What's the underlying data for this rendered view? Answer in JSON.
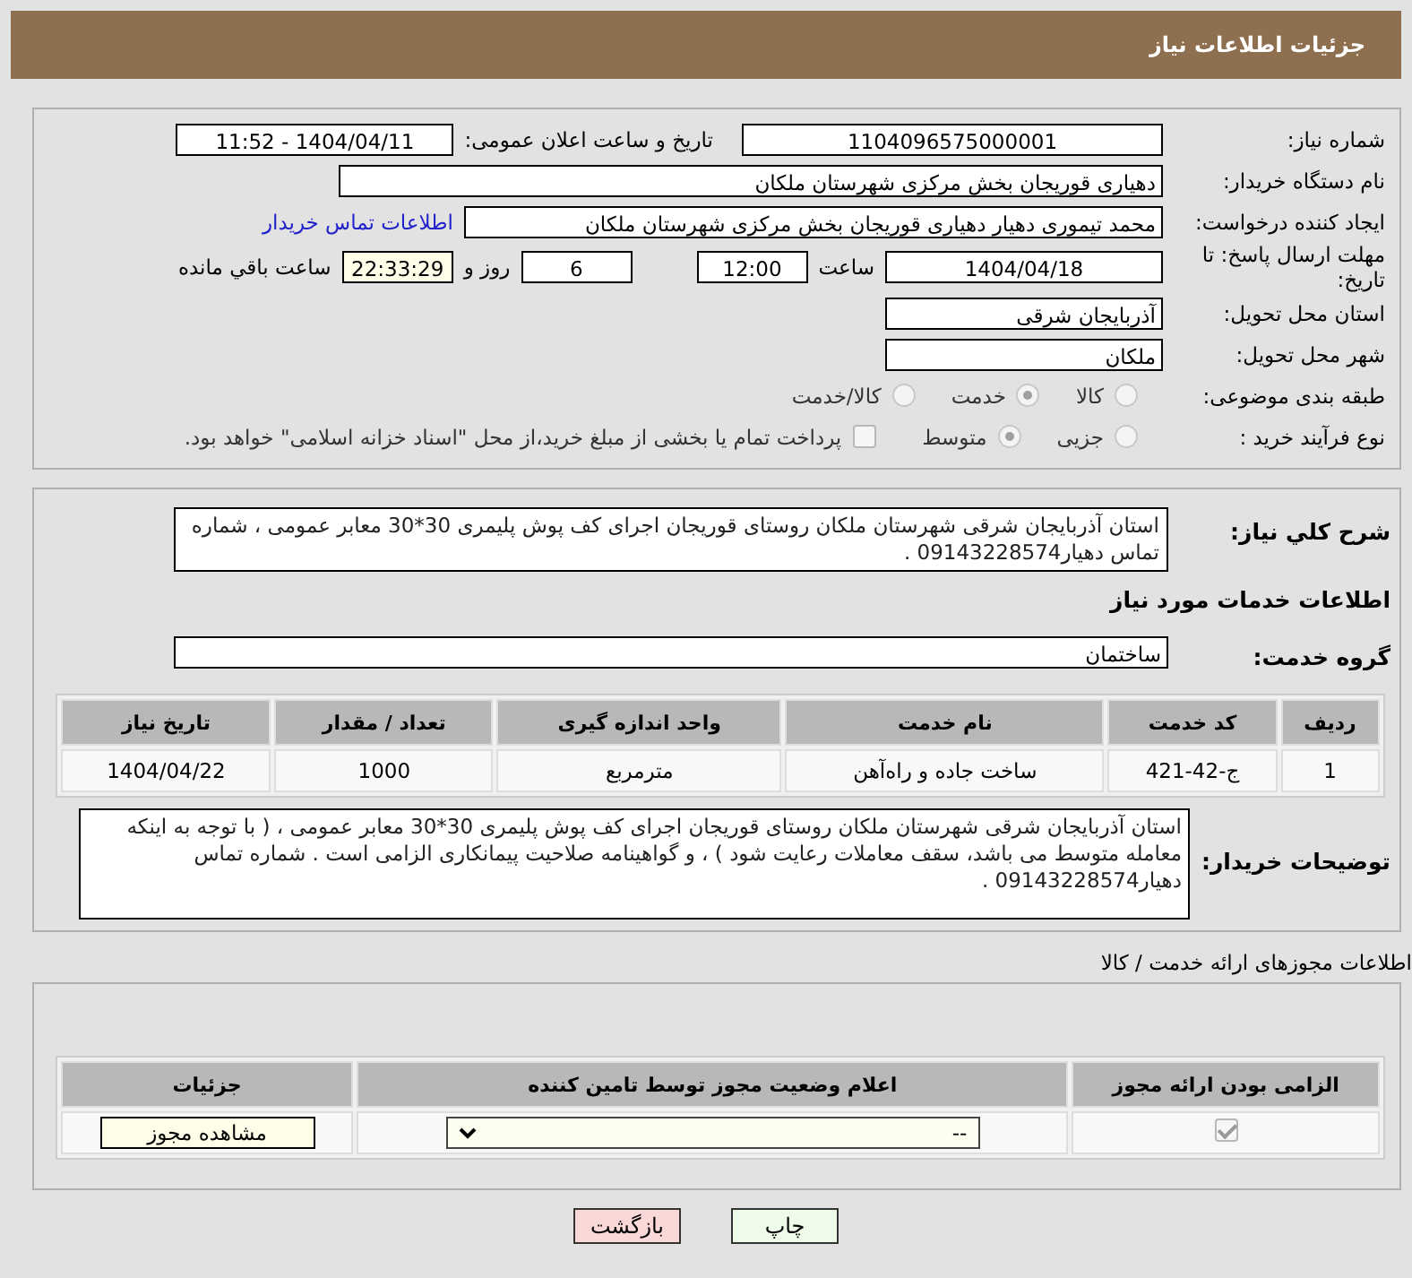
{
  "header": {
    "title": "جزئیات اطلاعات نیاز"
  },
  "details": {
    "need_number": {
      "label": "شماره نیاز:",
      "value": "1104096575000001"
    },
    "announce": {
      "label": "تاریخ و ساعت اعلان عمومی:",
      "value": "1404/04/11 - 11:52"
    },
    "buyer_org": {
      "label": "نام دستگاه خریدار:",
      "value": "دهیاری قوریجان بخش مرکزی شهرستان ملکان"
    },
    "requester": {
      "label": "ایجاد کننده درخواست:",
      "value": "محمد تیموری دهیار دهیاری قوریجان بخش مرکزی شهرستان ملکان",
      "link": "اطلاعات تماس خریدار"
    },
    "deadline": {
      "label": "مهلت ارسال پاسخ: تا تاریخ:",
      "date": "1404/04/18",
      "time_label": "ساعت",
      "time": "12:00",
      "days": "6",
      "days_label": "روز و",
      "remaining": "22:33:29",
      "remaining_label": "ساعت باقي مانده"
    },
    "province": {
      "label": "استان محل تحویل:",
      "value": "آذربایجان شرقی"
    },
    "city": {
      "label": "شهر محل تحویل:",
      "value": "ملکان"
    },
    "category": {
      "label": "طبقه بندی موضوعی:",
      "options": [
        {
          "label": "کالا",
          "selected": false
        },
        {
          "label": "خدمت",
          "selected": true
        },
        {
          "label": "کالا/خدمت",
          "selected": false
        }
      ]
    },
    "process": {
      "label": "نوع فرآیند خرید :",
      "options": [
        {
          "label": "جزیی",
          "selected": false
        },
        {
          "label": "متوسط",
          "selected": true
        }
      ],
      "payment": {
        "checked": false,
        "text": "پرداخت تمام یا بخشی از مبلغ خرید،از محل \"اسناد خزانه اسلامی\" خواهد بود."
      }
    }
  },
  "description": {
    "label": "شرح کلي نياز:",
    "text": "استان آذربایجان شرقی شهرستان ملکان روستای قوریجان اجرای کف پوش پلیمری 30*30 معابر عمومی ، شماره تماس دهیار09143228574 ."
  },
  "services_title": "اطلاعات خدمات مورد نیاز",
  "service_group": {
    "label": "گروه خدمت:",
    "value": "ساختمان"
  },
  "table": {
    "columns": [
      "ردیف",
      "کد خدمت",
      "نام خدمت",
      "واحد اندازه گیری",
      "تعداد / مقدار",
      "تاریخ نیاز"
    ],
    "rows": [
      [
        "1",
        "ج-42-421",
        "ساخت جاده و راه‌آهن",
        "مترمربع",
        "1000",
        "1404/04/22"
      ]
    ]
  },
  "buyer_notes": {
    "label": "توضیحات خریدار:",
    "text": "استان آذربایجان شرقی شهرستان ملکان روستای قوریجان اجرای کف پوش پلیمری 30*30 معابر عمومی ، ( با توجه به اینکه معامله متوسط می باشد، سقف معاملات رعایت شود ) ، و گواهینامه صلاحیت پیمانکاری الزامی است . شماره تماس دهیار09143228574 ."
  },
  "permits": {
    "title": "اطلاعات مجوزهای ارائه خدمت / کالا",
    "columns": [
      "الزامی بودن ارائه مجوز",
      "اعلام وضعیت مجوز توسط تامین کننده",
      "جزئیات"
    ],
    "rows": [
      {
        "required": true,
        "status": "--",
        "button": "مشاهده مجوز"
      }
    ]
  },
  "buttons": [
    {
      "label": "چاپ",
      "kind": "print"
    },
    {
      "label": "بازگشت",
      "kind": "back"
    }
  ]
}
